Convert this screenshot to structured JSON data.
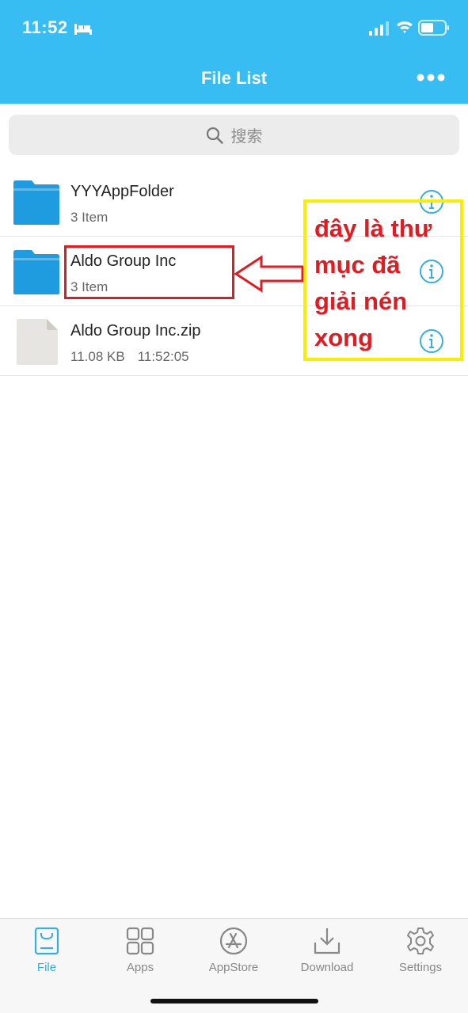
{
  "status_bar": {
    "time": "11:52",
    "icons": [
      "bed-icon",
      "signal-icon",
      "wifi-icon",
      "battery-icon"
    ]
  },
  "nav": {
    "title": "File List",
    "more_icon": "more-icon"
  },
  "search": {
    "placeholder": "搜索",
    "icon": "search-icon"
  },
  "files": [
    {
      "name": "YYYAppFolder",
      "meta": "3 Item",
      "type": "folder"
    },
    {
      "name": "Aldo Group Inc",
      "meta": "3 Item",
      "type": "folder"
    },
    {
      "name": "Aldo Group Inc.zip",
      "size": "11.08 KB",
      "time": "11:52:05",
      "type": "file"
    }
  ],
  "annotation": {
    "lines": [
      "đây là thư",
      "mục đã",
      "giải nén",
      "xong"
    ],
    "highlight_color": "#e01b22",
    "box_color": "#f8ef00"
  },
  "tabs": [
    {
      "label": "File",
      "icon": "file-tab-icon",
      "active": true
    },
    {
      "label": "Apps",
      "icon": "apps-grid-icon",
      "active": false
    },
    {
      "label": "AppStore",
      "icon": "appstore-icon",
      "active": false
    },
    {
      "label": "Download",
      "icon": "download-icon",
      "active": false
    },
    {
      "label": "Settings",
      "icon": "gear-icon",
      "active": false
    }
  ],
  "colors": {
    "accent": "#38bdf2",
    "tab_active": "#34aee3",
    "folder": "#1f9be0"
  }
}
